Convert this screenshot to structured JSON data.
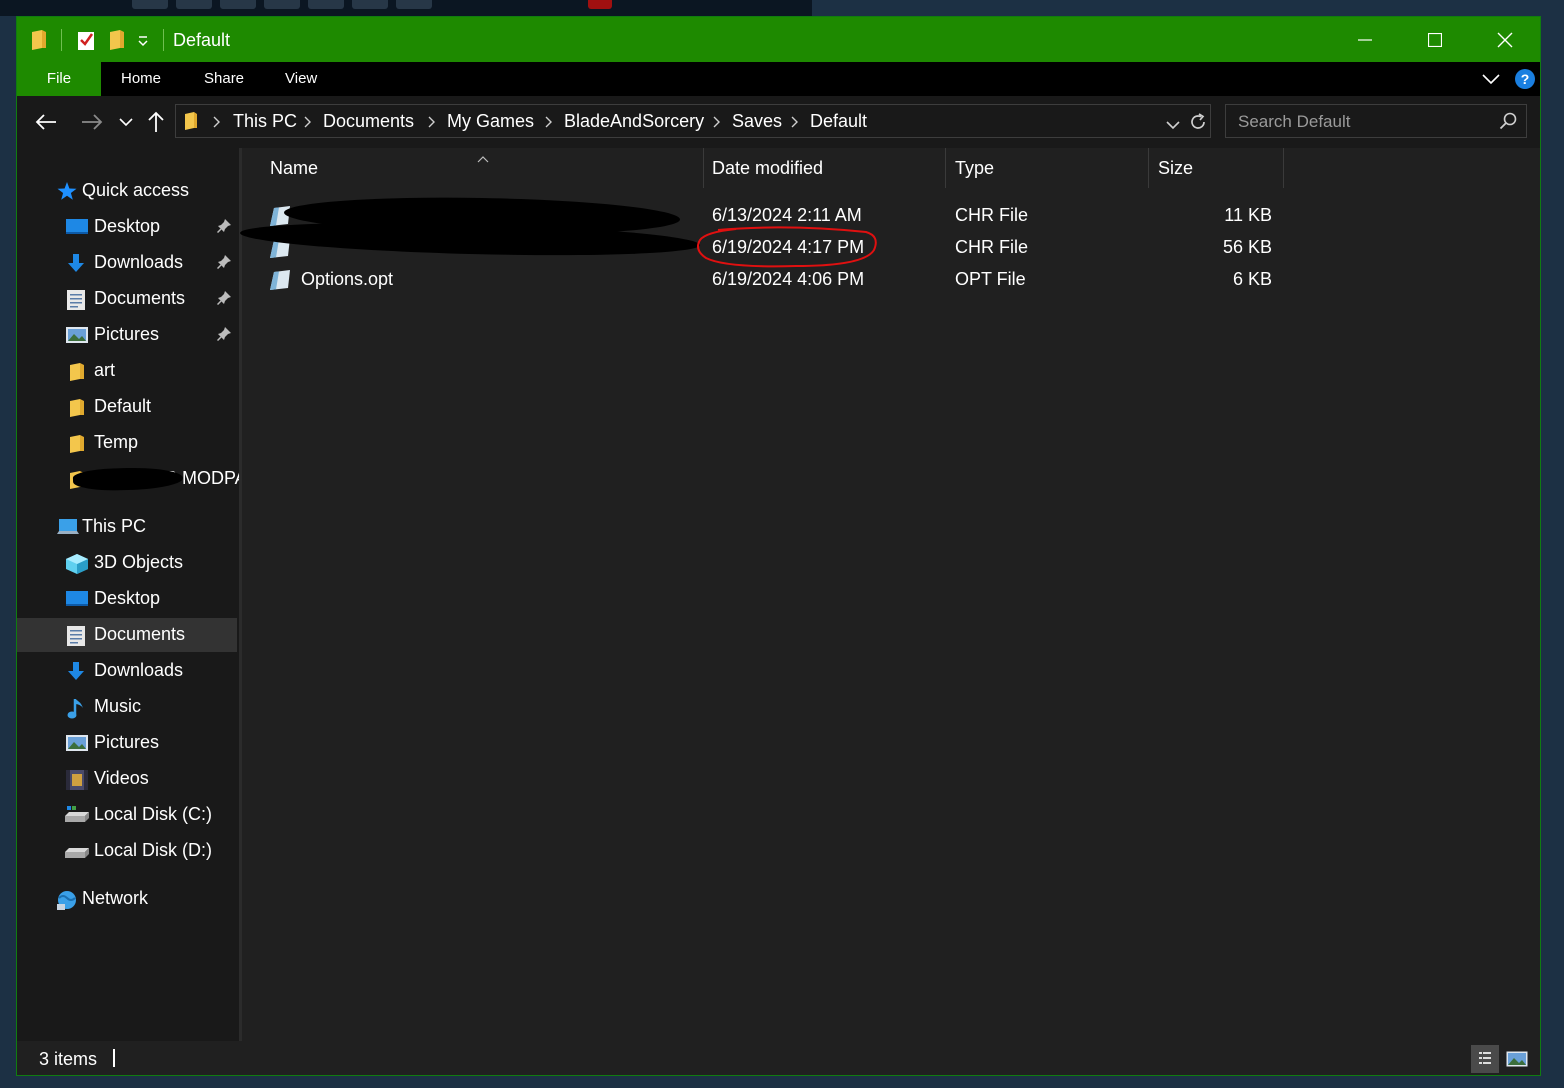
{
  "window": {
    "title": "Default",
    "accent_color": "#1e8a00"
  },
  "ribbon": {
    "tabs": [
      {
        "label": "File"
      },
      {
        "label": "Home"
      },
      {
        "label": "Share"
      },
      {
        "label": "View"
      }
    ]
  },
  "address": {
    "breadcrumbs": [
      "This PC",
      "Documents",
      "My Games",
      "BladeAndSorcery",
      "Saves",
      "Default"
    ],
    "search_placeholder": "Search Default"
  },
  "nav": {
    "quick_access": {
      "label": "Quick access",
      "items": [
        {
          "label": "Desktop",
          "icon": "desktop-icon",
          "pinned": true
        },
        {
          "label": "Downloads",
          "icon": "downloads-icon",
          "pinned": true
        },
        {
          "label": "Documents",
          "icon": "documents-icon",
          "pinned": true
        },
        {
          "label": "Pictures",
          "icon": "pictures-icon",
          "pinned": true
        },
        {
          "label": "art",
          "icon": "folder-icon",
          "pinned": false
        },
        {
          "label": "Default",
          "icon": "folder-icon",
          "pinned": false
        },
        {
          "label": "Temp",
          "icon": "folder-icon",
          "pinned": false
        },
        {
          "label": "S MODPA",
          "icon": "folder-icon",
          "pinned": false
        }
      ]
    },
    "this_pc": {
      "label": "This PC",
      "items": [
        {
          "label": "3D Objects",
          "icon": "3d-objects-icon"
        },
        {
          "label": "Desktop",
          "icon": "desktop-icon"
        },
        {
          "label": "Documents",
          "icon": "documents-icon",
          "selected": true
        },
        {
          "label": "Downloads",
          "icon": "downloads-icon"
        },
        {
          "label": "Music",
          "icon": "music-icon"
        },
        {
          "label": "Pictures",
          "icon": "pictures-icon"
        },
        {
          "label": "Videos",
          "icon": "videos-icon"
        },
        {
          "label": "Local Disk (C:)",
          "icon": "drive-c-icon"
        },
        {
          "label": "Local Disk (D:)",
          "icon": "drive-d-icon"
        }
      ]
    },
    "network": {
      "label": "Network"
    }
  },
  "file_list": {
    "columns": [
      "Name",
      "Date modified",
      "Type",
      "Size"
    ],
    "sort_column": "Name",
    "rows": [
      {
        "name": "",
        "date": "6/13/2024 2:11 AM",
        "type": "CHR File",
        "size": "11 KB",
        "redacted": true
      },
      {
        "name": "",
        "date": "6/19/2024 4:17 PM",
        "type": "CHR File",
        "size": "56 KB",
        "redacted": true,
        "circled": true
      },
      {
        "name": "Options.opt",
        "date": "6/19/2024 4:06 PM",
        "type": "OPT File",
        "size": "6 KB",
        "redacted": false
      }
    ]
  },
  "status": {
    "item_count": "3 items"
  },
  "annotation": {
    "circle_color": "#e01010"
  }
}
